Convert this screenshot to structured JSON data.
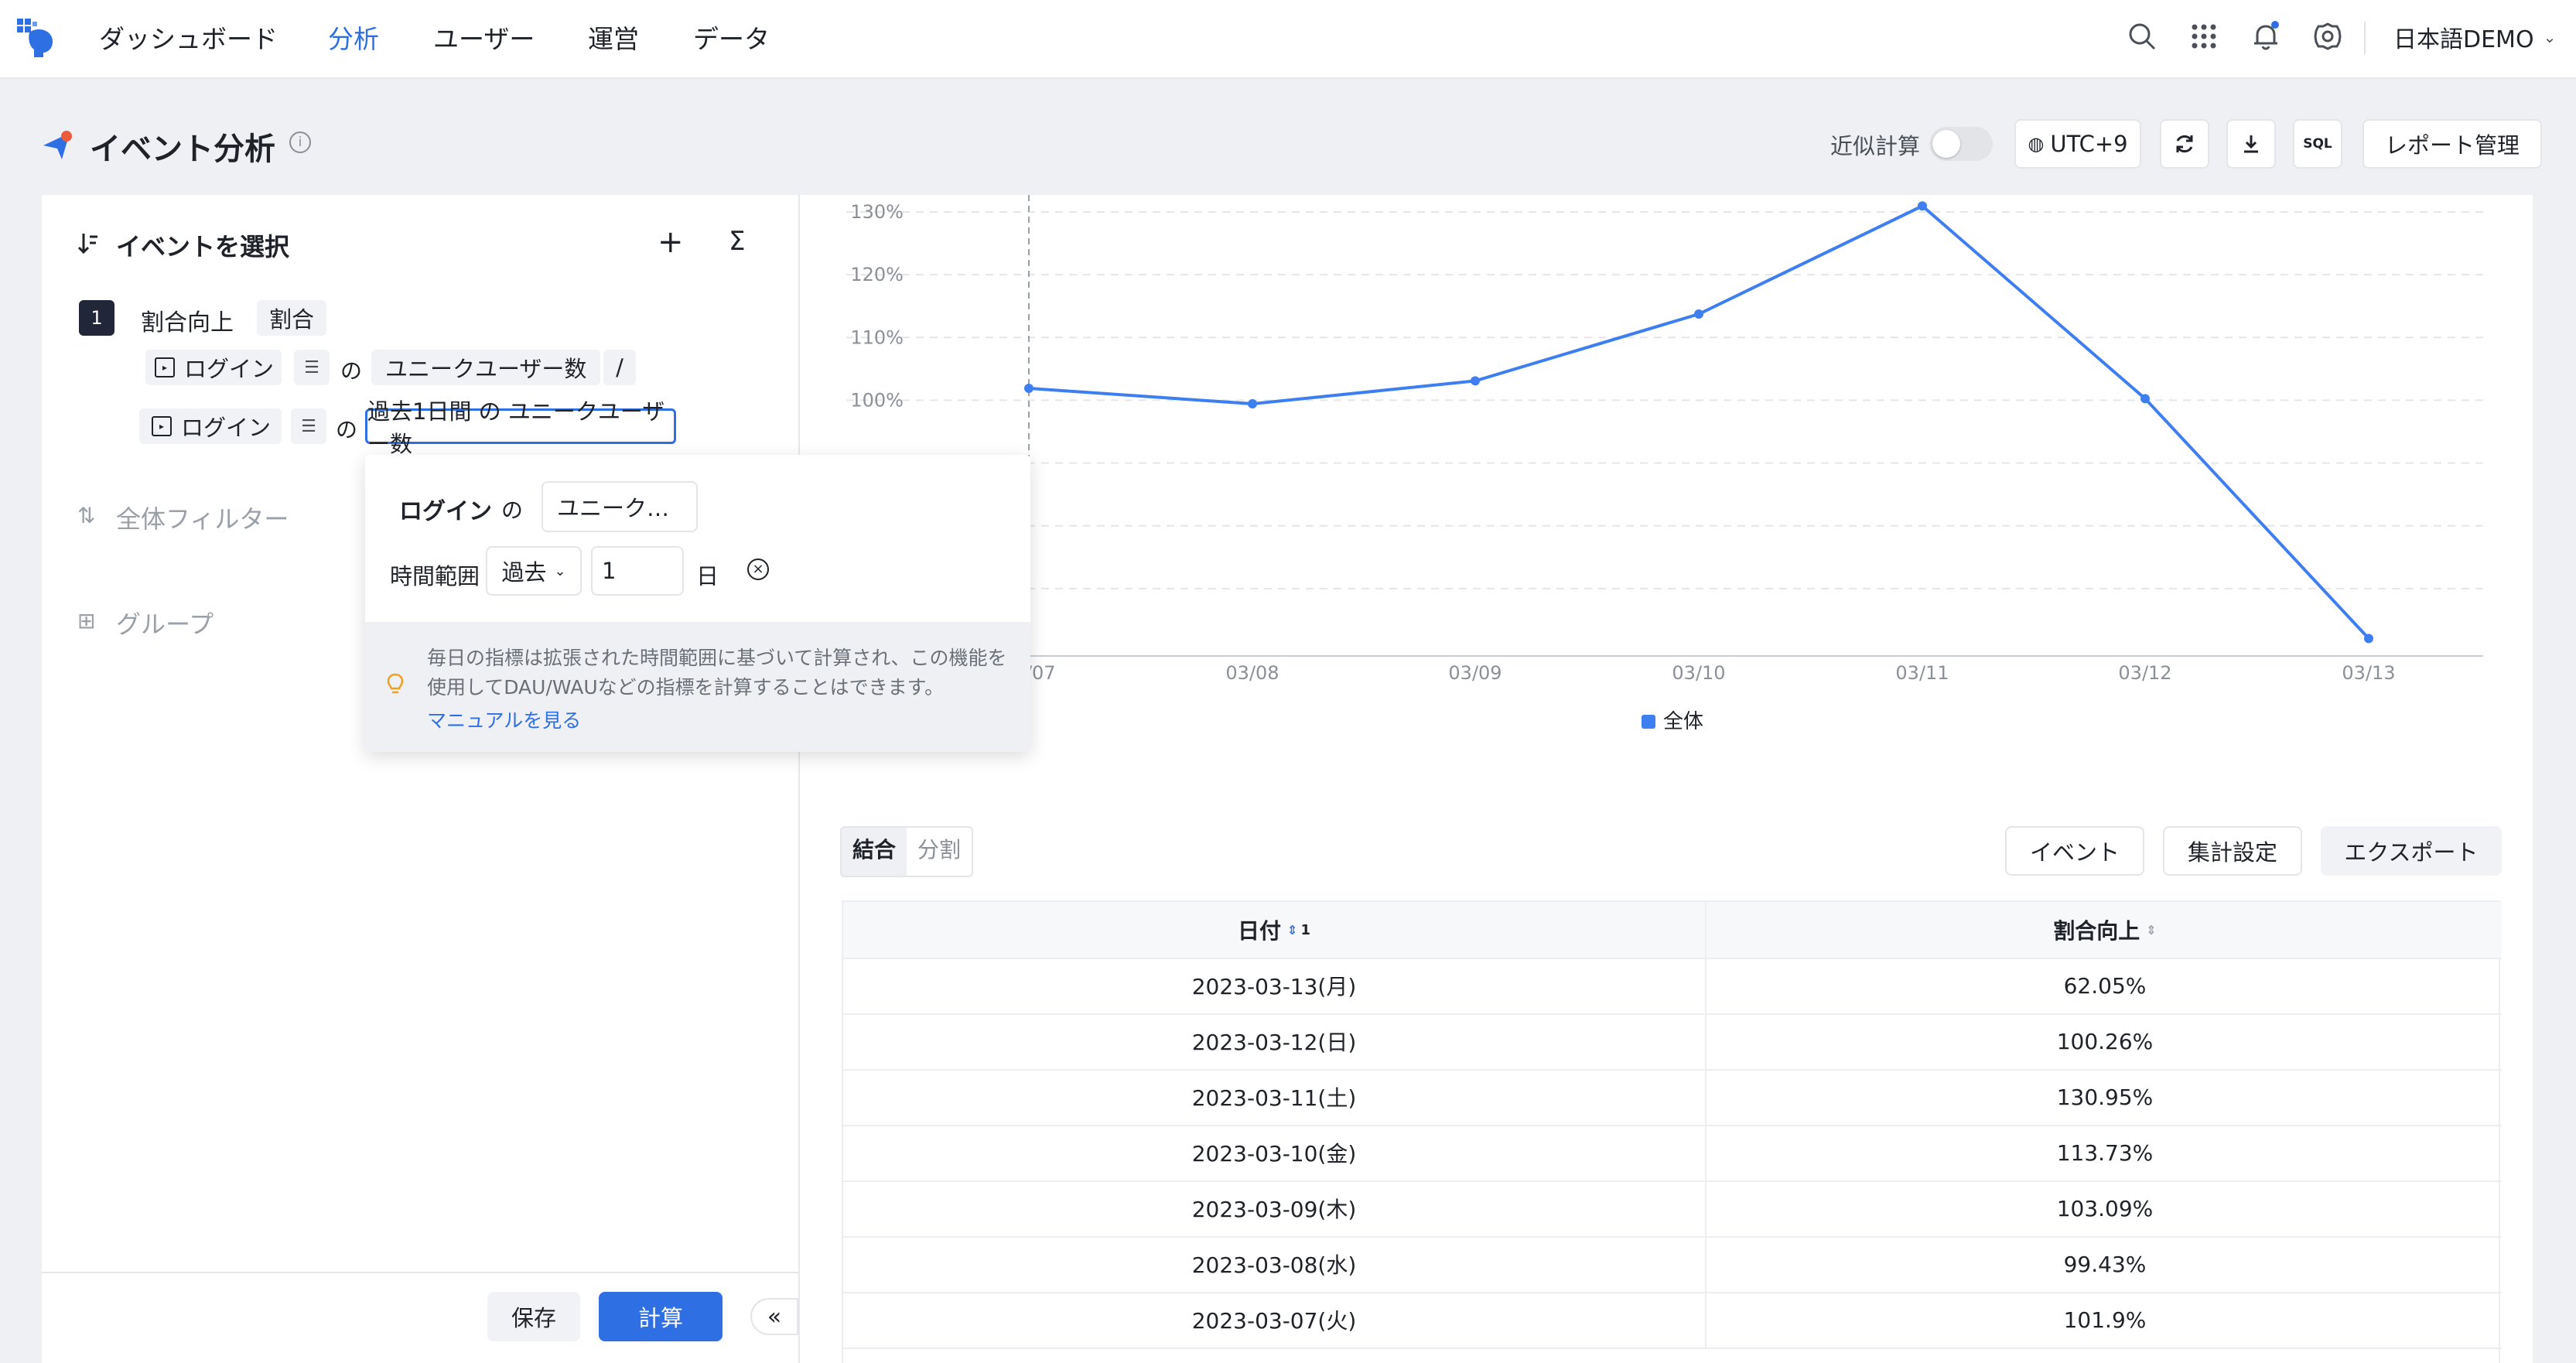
{
  "nav": {
    "items": [
      "ダッシュボード",
      "分析",
      "ユーザー",
      "運営",
      "データ"
    ],
    "active_index": 1,
    "workspace": "日本語DEMO",
    "icons": [
      "search-icon",
      "apps-grid-icon",
      "bell-icon",
      "gear-icon"
    ]
  },
  "header": {
    "title": "イベント分析",
    "approx_label": "近似計算",
    "approx_on": false,
    "timezone": "UTC+9",
    "sql_label": "SQL",
    "report_label": "レポート管理"
  },
  "left": {
    "select_title": "イベントを選択",
    "metric": {
      "index": "1",
      "name": "割合向上",
      "type_tag": "割合",
      "row1": {
        "event": "ログイン",
        "of": "の",
        "measure": "ユニークユーザー数",
        "op": "/"
      },
      "row2": {
        "event": "ログイン",
        "of": "の",
        "measure": "過去1日間 の ユニークユーザー数"
      }
    },
    "global_filter": "全体フィルター",
    "group": "グループ",
    "save_label": "保存",
    "calc_label": "計算"
  },
  "popup": {
    "event": "ログイン",
    "of": "の",
    "measure": "ユニーク…",
    "range_label": "時間範囲",
    "range_select": "過去",
    "range_value": "1",
    "unit": "日",
    "tip": "毎日の指標は拡張された時間範囲に基づいて計算され、この機能を使用してDAU/WAUなどの指標を計算することはできます。",
    "manual_link": "マニュアルを見る"
  },
  "chart_data": {
    "type": "line",
    "categories": [
      "03/07",
      "03/08",
      "03/09",
      "03/10",
      "03/11",
      "03/12",
      "03/13"
    ],
    "series": [
      {
        "name": "全体",
        "values": [
          101.9,
          99.43,
          103.09,
          113.73,
          130.95,
          100.26,
          62.05
        ],
        "color": "#3d7ef0"
      }
    ],
    "y_ticks": [
      "100%",
      "110%",
      "120%",
      "130%"
    ],
    "ylim": [
      60,
      130
    ],
    "grid": true,
    "legend": "bottom"
  },
  "table_controls": {
    "merge": "結合",
    "split": "分割",
    "event_btn": "イベント",
    "agg_btn": "集計設定",
    "export_btn": "エクスポート"
  },
  "table": {
    "headers": [
      "日付",
      "割合向上"
    ],
    "sort_index": "1",
    "rows": [
      [
        "2023-03-13(月)",
        "62.05%"
      ],
      [
        "2023-03-12(日)",
        "100.26%"
      ],
      [
        "2023-03-11(土)",
        "130.95%"
      ],
      [
        "2023-03-10(金)",
        "113.73%"
      ],
      [
        "2023-03-09(木)",
        "103.09%"
      ],
      [
        "2023-03-08(水)",
        "99.43%"
      ],
      [
        "2023-03-07(火)",
        "101.9%"
      ]
    ]
  }
}
